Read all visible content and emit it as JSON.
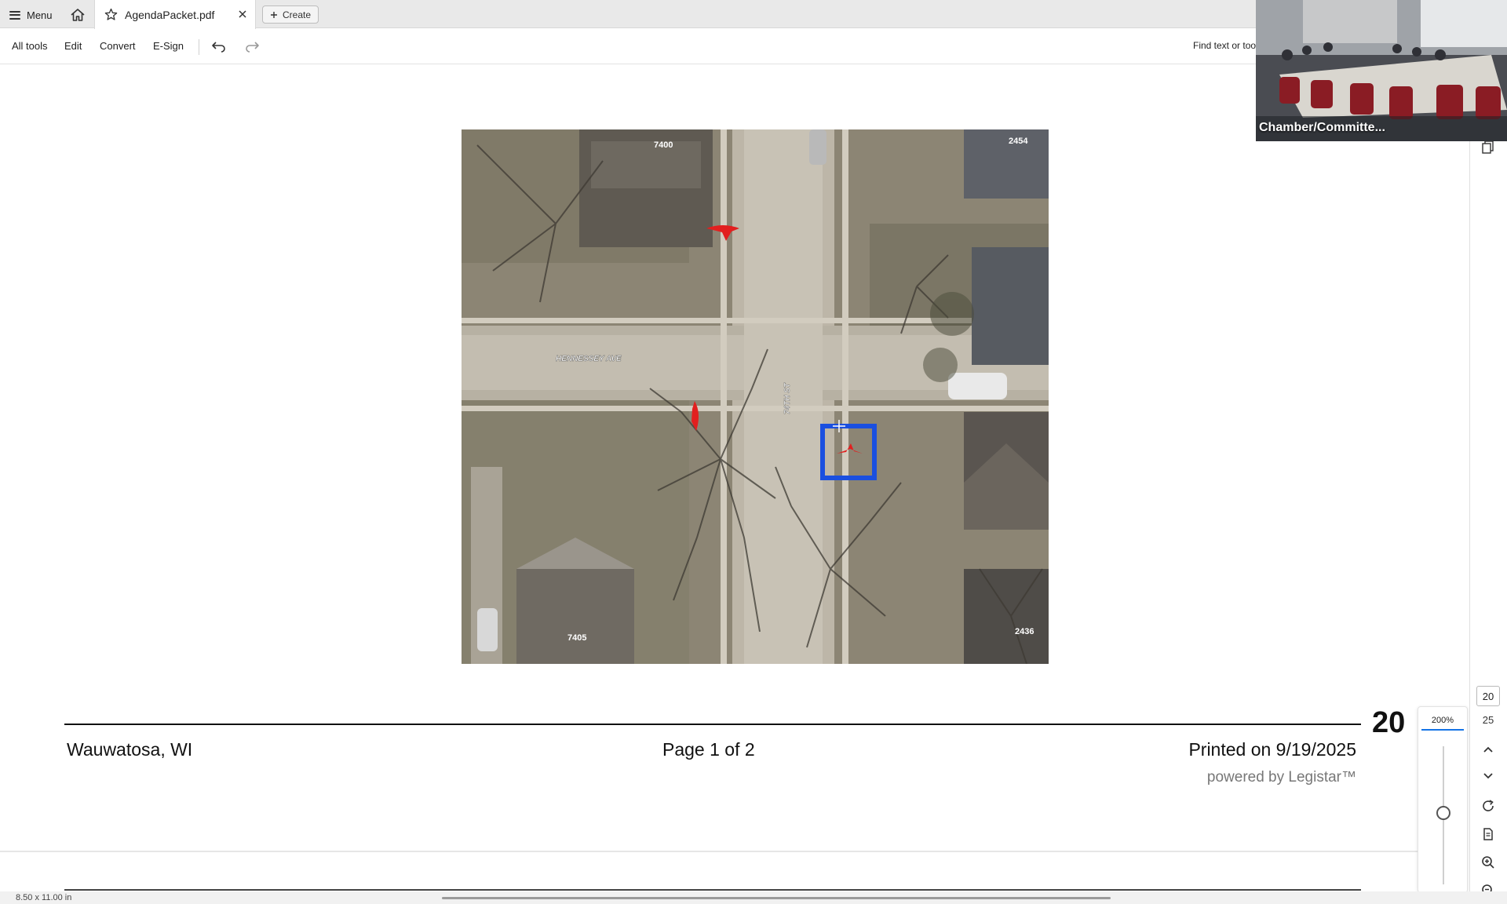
{
  "tabbar": {
    "menu_label": "Menu",
    "tab_title": "AgendaPacket.pdf",
    "create_label": "Create"
  },
  "toolbar": {
    "all_tools": "All tools",
    "edit": "Edit",
    "convert": "Convert",
    "esign": "E-Sign",
    "find_text": "Find text or too"
  },
  "toolrail": {
    "items": [
      "select-hand",
      "add-comment",
      "highlight",
      "draw-freeform",
      "text-select",
      "sign",
      "more"
    ]
  },
  "map": {
    "labels": {
      "house_top_left": "7400",
      "house_top_right": "2454",
      "street_ew": "HENNESSEY AVE",
      "street_ns": "74TH ST",
      "house_bottom_left": "7405",
      "house_bottom_right": "2436"
    },
    "colors": {
      "marker": "#e21f1f",
      "selection": "#1a4fe0"
    }
  },
  "footer": {
    "city": "Wauwatosa, WI",
    "page_info": "Page 1 of 2",
    "printed": "Printed on 9/19/2025",
    "powered": "powered by Legistar™"
  },
  "navigation": {
    "page_big": "20",
    "page_current": "20",
    "page_total": "25",
    "zoom": "200%"
  },
  "video": {
    "label": "Chamber/Committe..."
  },
  "status": {
    "page_size": "8.50 x 11.00 in"
  },
  "colors": {
    "accent": "#1473e6"
  }
}
